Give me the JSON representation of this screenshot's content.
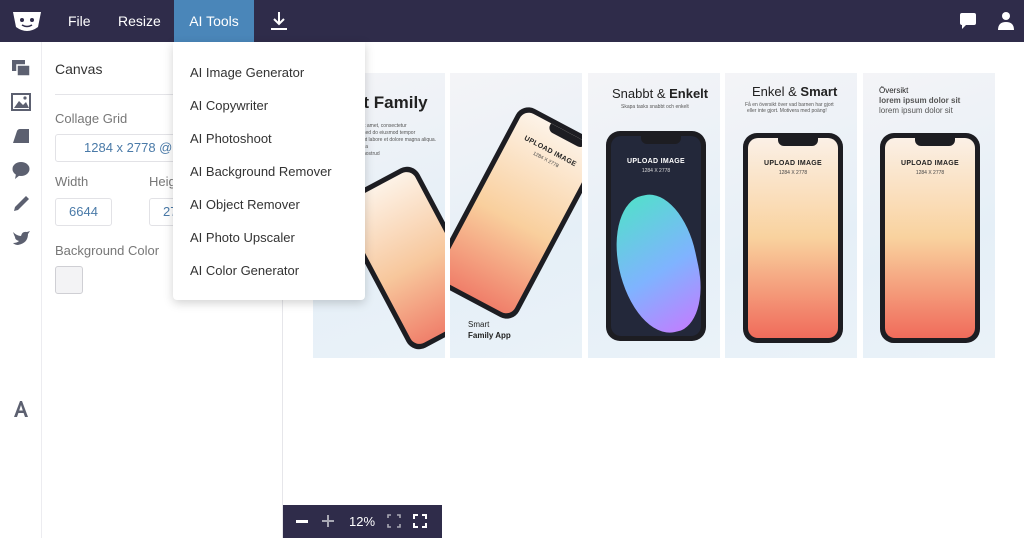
{
  "topbar": {
    "menu": {
      "file": "File",
      "resize": "Resize",
      "ai_tools": "AI Tools"
    },
    "icons": [
      "logo-icon",
      "download-icon",
      "chat-icon",
      "user-icon"
    ],
    "colors": {
      "bar": "#2f2c4a",
      "active": "#4a86b9"
    }
  },
  "ai_menu": {
    "items": [
      "AI Image Generator",
      "AI Copywriter",
      "AI Photoshoot",
      "AI Background Remover",
      "AI Object Remover",
      "AI Photo Upscaler",
      "AI Color Generator"
    ]
  },
  "toolrail": {
    "icons": [
      "templates-icon",
      "image-icon",
      "shapes-icon",
      "speech-bubble-icon",
      "pen-icon",
      "bird-icon",
      "text-icon"
    ]
  },
  "panel": {
    "title": "Canvas",
    "collage_grid_label": "Collage Grid",
    "collage_grid_value": "1284 x 2778 @ 5",
    "width_label": "Width",
    "width_value": "6644",
    "height_label": "Heig",
    "height_value": "27",
    "bg_color_label": "Background Color",
    "bg_color": "#f3f3f5"
  },
  "collage": {
    "tile1": {
      "title": "ot Family",
      "sub1": "it amet, consectetur",
      "sub2": "sed do eiusmod tempor",
      "sub3": "ut labore et dolore magna aliqua.",
      "sub4": "lia",
      "sub5": "nostrud"
    },
    "tile2": {
      "upload": "UPLOAD IMAGE",
      "size": "1284 X 2778",
      "caption1": "Smart",
      "caption2": "Family App"
    },
    "tile3": {
      "title_a": "Snabbt & ",
      "title_b": "Enkelt",
      "sub": "Skapa tasks snabbt och enkelt",
      "upload": "UPLOAD IMAGE",
      "size": "1284 X 2778"
    },
    "tile4": {
      "title_a": "Enkel & ",
      "title_b": "Smart",
      "sub1": "Få en översikt över vad barnen har gjort",
      "sub2": "eller inte gjort. Motivera med poäng!",
      "upload": "UPLOAD IMAGE",
      "size": "1284 X 2778"
    },
    "tile5": {
      "title": "Översikt",
      "sub1": "lorem ipsum dolor sit",
      "sub2": "lorem ipsum dolor sit",
      "upload": "UPLOAD IMAGE",
      "size": "1284 X 2778"
    }
  },
  "zoom": {
    "value": "12%"
  }
}
